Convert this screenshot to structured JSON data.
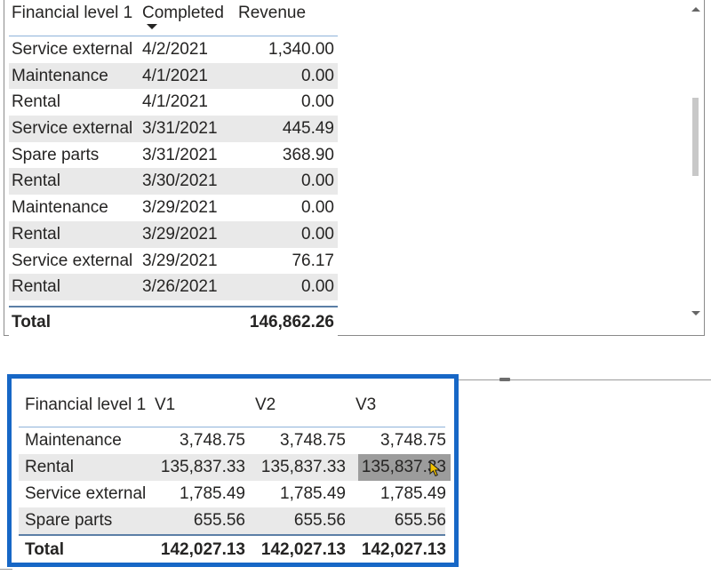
{
  "top_table": {
    "headers": [
      "Financial level 1",
      "Completed",
      "Revenue"
    ],
    "rows": [
      [
        "Service external",
        "4/2/2021",
        "1,340.00"
      ],
      [
        "Maintenance",
        "4/1/2021",
        "0.00"
      ],
      [
        "Rental",
        "4/1/2021",
        "0.00"
      ],
      [
        "Service external",
        "3/31/2021",
        "445.49"
      ],
      [
        "Spare parts",
        "3/31/2021",
        "368.90"
      ],
      [
        "Rental",
        "3/30/2021",
        "0.00"
      ],
      [
        "Maintenance",
        "3/29/2021",
        "0.00"
      ],
      [
        "Rental",
        "3/29/2021",
        "0.00"
      ],
      [
        "Service external",
        "3/29/2021",
        "76.17"
      ],
      [
        "Rental",
        "3/26/2021",
        "0.00"
      ]
    ],
    "total_label": "Total",
    "total_value": "146,862.26"
  },
  "matrix": {
    "headers": [
      "Financial level 1",
      "V1",
      "V2",
      "V3"
    ],
    "rows": [
      [
        "Maintenance",
        "3,748.75",
        "3,748.75",
        "3,748.75"
      ],
      [
        "Rental",
        "135,837.33",
        "135,837.33",
        "135,837.33"
      ],
      [
        "Service external",
        "1,785.49",
        "1,785.49",
        "1,785.49"
      ],
      [
        "Spare parts",
        "655.56",
        "655.56",
        "655.56"
      ]
    ],
    "total": [
      "Total",
      "142,027.13",
      "142,027.13",
      "142,027.13"
    ]
  },
  "colors": {
    "selection_border": "#1767c6",
    "row_band": "#e9e9e9",
    "highlight_cell": "#9c9c9c"
  },
  "icons": {
    "sort": "sort-descending-icon",
    "cursor": "mouse-pointer-icon"
  }
}
